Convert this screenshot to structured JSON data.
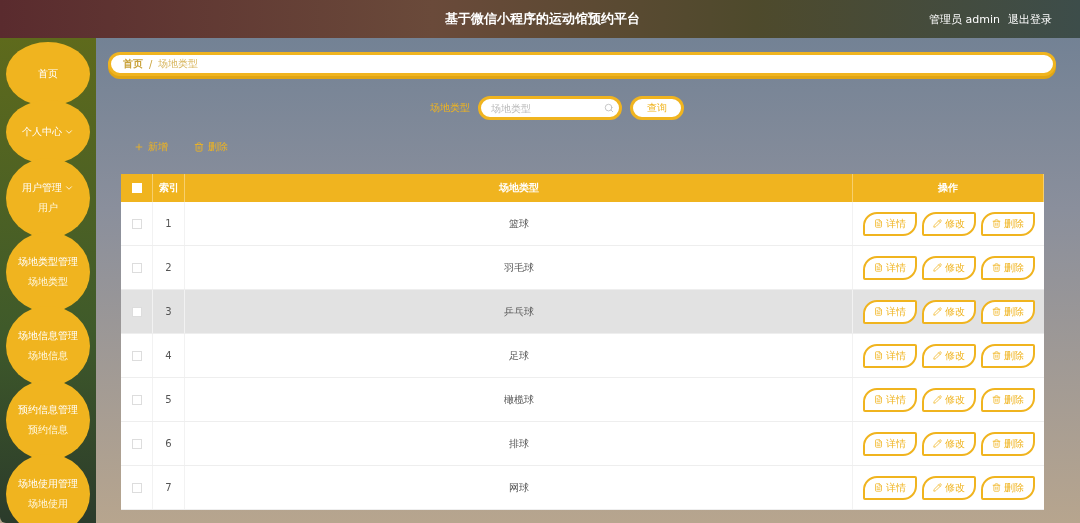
{
  "header": {
    "title": "基于微信小程序的运动馆预约平台",
    "user": "管理员 admin",
    "logout": "退出登录"
  },
  "sidebar": {
    "items": [
      {
        "label": "首页",
        "expandable": false
      },
      {
        "label": "个人中心",
        "expandable": true
      },
      {
        "label": "用户管理",
        "expandable": true,
        "children": [
          {
            "label": "用户"
          }
        ]
      },
      {
        "label": "场地类型管理",
        "expandable": false,
        "children": [
          {
            "label": "场地类型"
          }
        ]
      },
      {
        "label": "场地信息管理",
        "expandable": false,
        "children": [
          {
            "label": "场地信息"
          }
        ]
      },
      {
        "label": "预约信息管理",
        "expandable": false,
        "children": [
          {
            "label": "预约信息"
          }
        ]
      },
      {
        "label": "场地使用管理",
        "expandable": false,
        "children": [
          {
            "label": "场地使用"
          }
        ]
      }
    ]
  },
  "breadcrumb": {
    "items": [
      "首页",
      "场地类型"
    ],
    "separator": "/"
  },
  "search": {
    "label": "场地类型",
    "placeholder": "场地类型",
    "button": "查询"
  },
  "actions": [
    "新增",
    "删除"
  ],
  "table": {
    "columns": [
      "索引",
      "场地类型",
      "操作"
    ],
    "select_all_checked": false,
    "rows": [
      {
        "index": "1",
        "type": "篮球",
        "checked": false,
        "highlighted": false,
        "buttons": [
          "详情",
          "修改",
          "删除"
        ]
      },
      {
        "index": "2",
        "type": "羽毛球",
        "checked": false,
        "highlighted": false,
        "buttons": [
          "详情",
          "修改",
          "删除"
        ]
      },
      {
        "index": "3",
        "type": "乒乓球",
        "checked": false,
        "highlighted": true,
        "buttons": [
          "详情",
          "修改",
          "删除"
        ]
      },
      {
        "index": "4",
        "type": "足球",
        "checked": false,
        "highlighted": false,
        "buttons": [
          "详情",
          "修改",
          "删除"
        ]
      },
      {
        "index": "5",
        "type": "橄榄球",
        "checked": false,
        "highlighted": false,
        "buttons": [
          "详情",
          "修改",
          "删除"
        ]
      },
      {
        "index": "6",
        "type": "排球",
        "checked": false,
        "highlighted": false,
        "buttons": [
          "详情",
          "修改",
          "删除"
        ]
      },
      {
        "index": "7",
        "type": "网球",
        "checked": false,
        "highlighted": false,
        "buttons": [
          "详情",
          "修改",
          "删除"
        ]
      }
    ]
  }
}
